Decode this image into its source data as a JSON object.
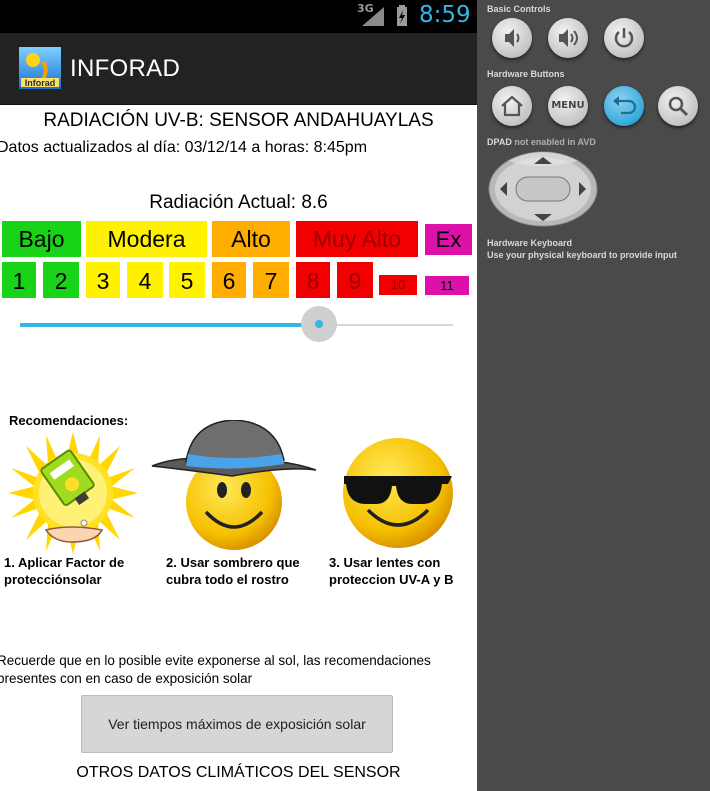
{
  "status_bar": {
    "network": "3G",
    "time": "8:59"
  },
  "app": {
    "title": "INFORAD",
    "logo_text": "Inforad"
  },
  "main": {
    "title": "RADIACIÓN UV-B: SENSOR ANDAHUAYLAS",
    "updated": "Datos actualizados al día: 03/12/14 a horas:  8:45pm",
    "current": "Radiación Actual: 8.6",
    "current_value": 8.6
  },
  "scale": {
    "categories": [
      {
        "label": "Bajo",
        "color": "#19d319"
      },
      {
        "label": "Modera",
        "color": "#fff200"
      },
      {
        "label": "Alto",
        "color": "#ffad00"
      },
      {
        "label": "Muy Alto",
        "color": "#f20000"
      },
      {
        "label": "Ex",
        "color": "#dd11a9"
      }
    ],
    "levels": [
      {
        "label": "1",
        "color": "#19d319"
      },
      {
        "label": "2",
        "color": "#19d319"
      },
      {
        "label": "3",
        "color": "#fff200"
      },
      {
        "label": "4",
        "color": "#fff200"
      },
      {
        "label": "5",
        "color": "#fff200"
      },
      {
        "label": "6",
        "color": "#ffad00"
      },
      {
        "label": "7",
        "color": "#ffad00"
      },
      {
        "label": "8",
        "color": "#f20000"
      },
      {
        "label": "9",
        "color": "#f20000"
      },
      {
        "label": "10",
        "color": "#f20000"
      },
      {
        "label": "11",
        "color": "#dd11a9"
      }
    ]
  },
  "slider": {
    "value_fraction": 0.69,
    "accent": "#33b5e5"
  },
  "recommendations": {
    "title": "Recomendaciones:",
    "items": [
      {
        "icon": "sunscreen-icon",
        "caption_line1": "1. Aplicar Factor de",
        "caption_line2": "protecciónsolar"
      },
      {
        "icon": "hat-smiley-icon",
        "caption_line1": "2. Usar sombrero que",
        "caption_line2": "cubra todo el rostro"
      },
      {
        "icon": "sunglasses-smiley-icon",
        "caption_line1": "3. Usar lentes con",
        "caption_line2": "proteccion UV-A y B"
      }
    ]
  },
  "note": {
    "line1": "Recuerde que en lo posible evite exponerse al sol, las recomendaciones",
    "line2": "presentes con en caso de exposición solar"
  },
  "button": {
    "label": "Ver tiempos máximos de exposición solar"
  },
  "footer": {
    "other_data": "OTROS DATOS CLIMÁTICOS DEL SENSOR"
  },
  "emulator": {
    "basic_controls": "Basic Controls",
    "hardware_buttons": "Hardware Buttons",
    "menu_label": "MENU",
    "dpad_label": "DPAD",
    "dpad_note": "not enabled in AVD",
    "keyboard_title": "Hardware Keyboard",
    "keyboard_sub": "Use your physical keyboard to provide input"
  }
}
